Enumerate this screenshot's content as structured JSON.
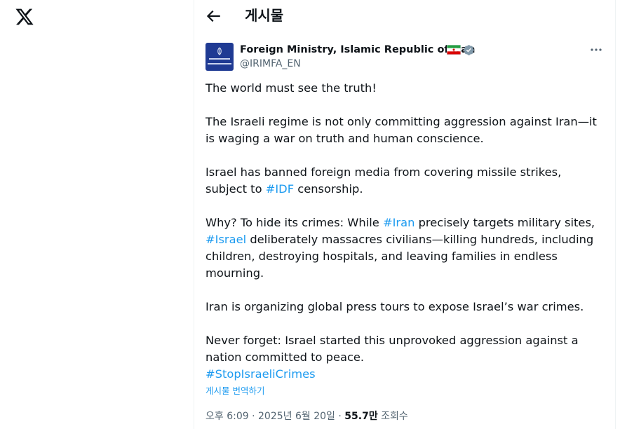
{
  "header": {
    "title": "게시물"
  },
  "author": {
    "name": "Foreign Ministry, Islamic Republic of Iran",
    "handle": "@IRIMFA_EN"
  },
  "tweet": {
    "p1": "The world must see the truth!",
    "p2": "The Israeli regime is not only committing aggression against Iran—it is waging a war on truth and human conscience.",
    "p3_a": "Israel has banned foreign media from covering missile strikes, subject to ",
    "p3_tag": "#IDF",
    "p3_b": " censorship.",
    "p4_a": "Why? To hide its crimes: While ",
    "p4_tag1": "#Iran",
    "p4_b": " precisely targets military sites, ",
    "p4_tag2": "#Israel",
    "p4_c": " deliberately massacres civilians—killing hundreds, including children, destroying hospitals, and leaving families in endless mourning.",
    "p5": "Iran is organizing global press tours to expose Israel’s war crimes.",
    "p6": "Never forget: Israel started this unprovoked aggression against a nation committed to peace.",
    "hashtag": "#StopIsraeliCrimes",
    "translate": "게시물 번역하기"
  },
  "meta": {
    "time": "오후 6:09",
    "sep": " · ",
    "date": "2025년 6월 20일",
    "views": "55.7만",
    "views_label": " 조회수"
  },
  "colors": {
    "link": "#1d9bf0",
    "muted": "#536471",
    "text": "#0f1419"
  },
  "icons": [
    "x-logo-icon",
    "back-arrow-icon",
    "iran-flag-icon",
    "verified-badge-icon",
    "more-icon"
  ]
}
